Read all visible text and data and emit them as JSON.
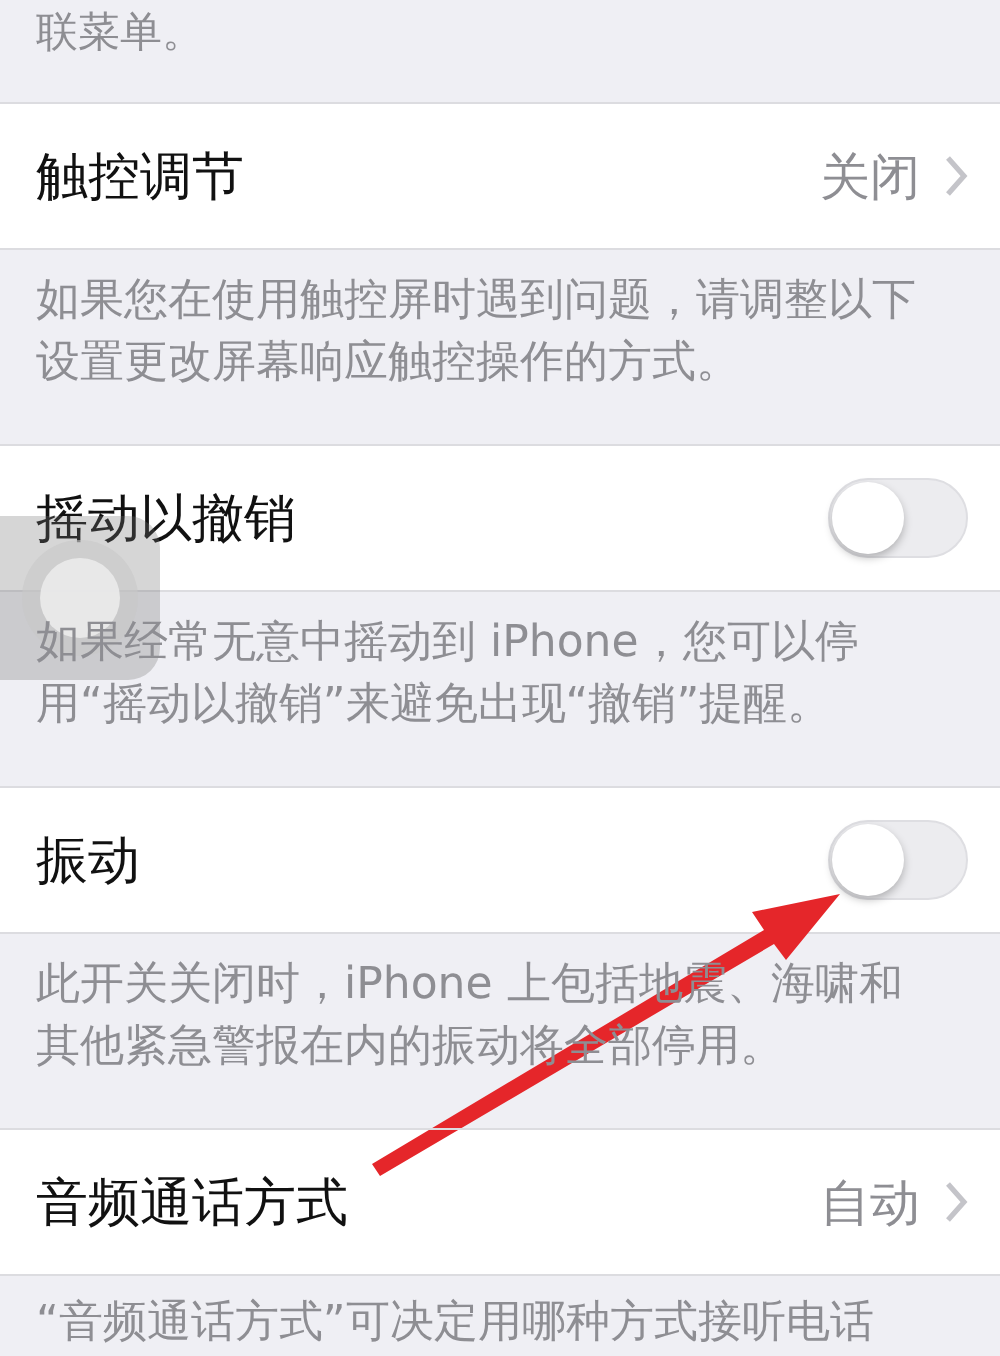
{
  "top_note": "联菜单。",
  "sections": [
    {
      "kind": "link",
      "title": "触控调节",
      "value": "关闭",
      "note": "如果您在使用触控屏时遇到问题，请调整以下设置更改屏幕响应触控操作的方式。"
    },
    {
      "kind": "toggle",
      "title": "摇动以撤销",
      "on": false,
      "note": "如果经常无意中摇动到 iPhone，您可以停用“摇动以撤销”来避免出现“撤销”提醒。"
    },
    {
      "kind": "toggle",
      "title": "振动",
      "on": false,
      "note": "此开关关闭时，iPhone 上包括地震、海啸和其他紧急警报在内的振动将全部停用。"
    },
    {
      "kind": "link",
      "title": "音频通话方式",
      "value": "自动",
      "note": "“音频通话方式”可决定用哪种方式接听电话"
    }
  ]
}
